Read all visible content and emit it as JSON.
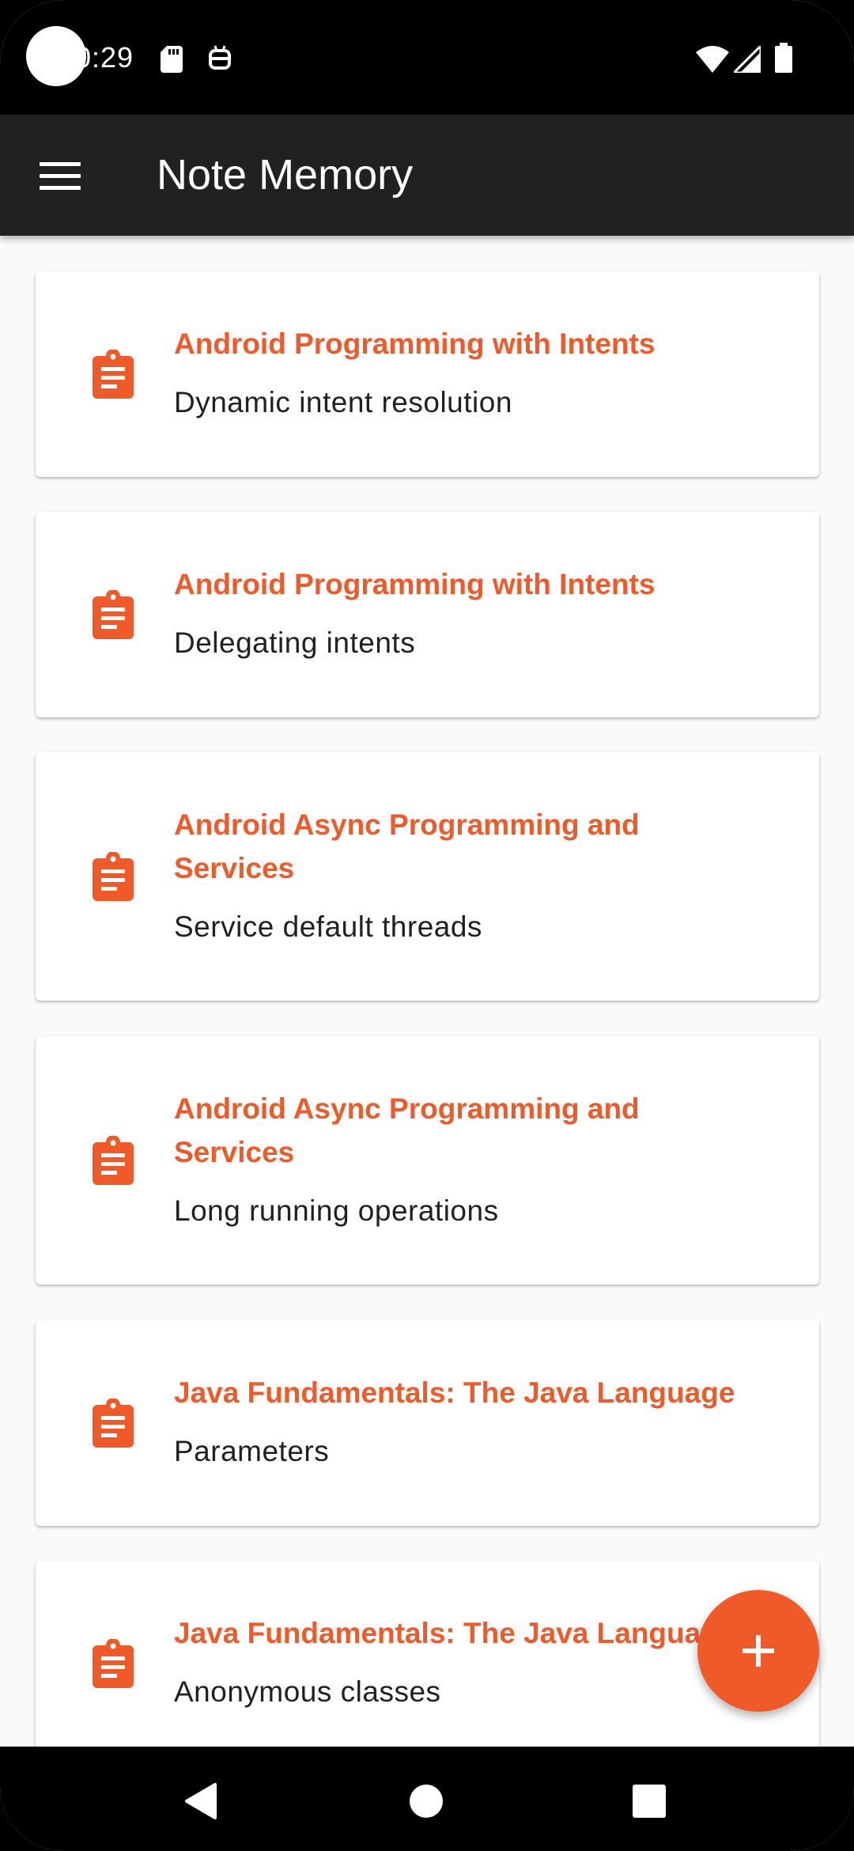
{
  "status_bar": {
    "time": "0:29"
  },
  "app_bar": {
    "title": "Note Memory"
  },
  "notes": [
    {
      "course": "Android Programming with Intents",
      "title": "Dynamic intent resolution"
    },
    {
      "course": "Android Programming with Intents",
      "title": "Delegating intents"
    },
    {
      "course": "Android Async Programming and Services",
      "title": "Service default threads"
    },
    {
      "course": "Android Async Programming and Services",
      "title": "Long running operations"
    },
    {
      "course": "Java Fundamentals: The Java Language",
      "title": "Parameters"
    },
    {
      "course": "Java Fundamentals: The Java Language",
      "title": "Anonymous classes"
    }
  ],
  "colors": {
    "accent": "#f05a28",
    "app_bar": "#212121",
    "background": "#fafafa"
  },
  "icons": {
    "note": "assignment-icon",
    "fab": "add-icon"
  }
}
